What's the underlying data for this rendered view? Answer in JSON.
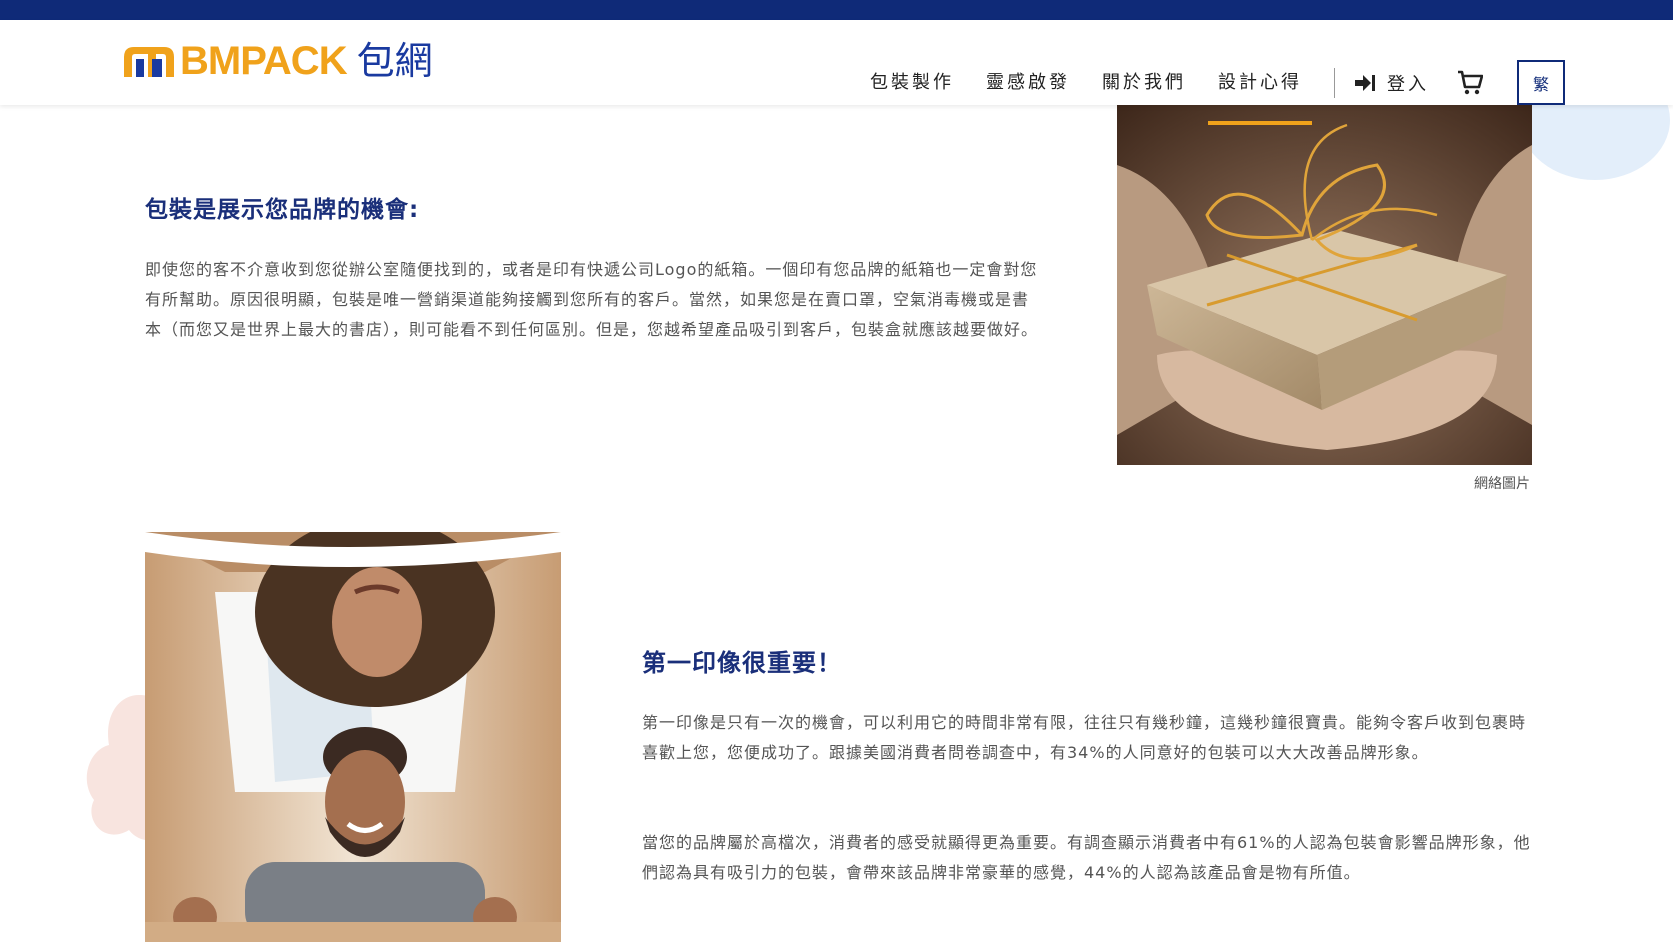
{
  "header": {
    "logo_text": "BMPACK",
    "logo_cn": "包網",
    "nav": [
      "包裝製作",
      "靈感啟發",
      "關於我們",
      "設計心得"
    ],
    "active_nav": "設計心得",
    "login_label": "登入",
    "lang_label": "繁"
  },
  "section1": {
    "title": "包裝是展示您品牌的機會:",
    "body": "即使您的客不介意收到您從辦公室隨便找到的，或者是印有快遞公司Logo的紙箱。一個印有您品牌的紙箱也一定會對您有所幫助。原因很明顯，包裝是唯一營銷渠道能夠接觸到您所有的客戶。當然，如果您是在賣口罩，空氣消毒機或是書本（而您又是世界上最大的書店），則可能看不到任何區別。但是，您越希望產品吸引到客戶，包裝盒就應該越要做好。",
    "image_caption": "網絡圖片"
  },
  "section2": {
    "title": "第一印像很重要！",
    "body1": "第一印像是只有一次的機會，可以利用它的時間非常有限，往往只有幾秒鐘，這幾秒鐘很寶貴。能夠令客戶收到包裹時喜歡上您，您便成功了。跟據美國消費者問卷調查中，有34%的人同意好的包裝可以大大改善品牌形象。",
    "body2": "當您的品牌屬於高檔次，消費者的感受就顯得更為重要。有調查顯示消費者中有61%的人認為包裝會影響品牌形象，他們認為具有吸引力的包裝，會帶來該品牌非常豪華的感覺，44%的人認為該產品會是物有所值。"
  },
  "colors": {
    "navy": "#0f2a78",
    "accent": "#f0a21b",
    "heading": "#1a2f7a"
  }
}
